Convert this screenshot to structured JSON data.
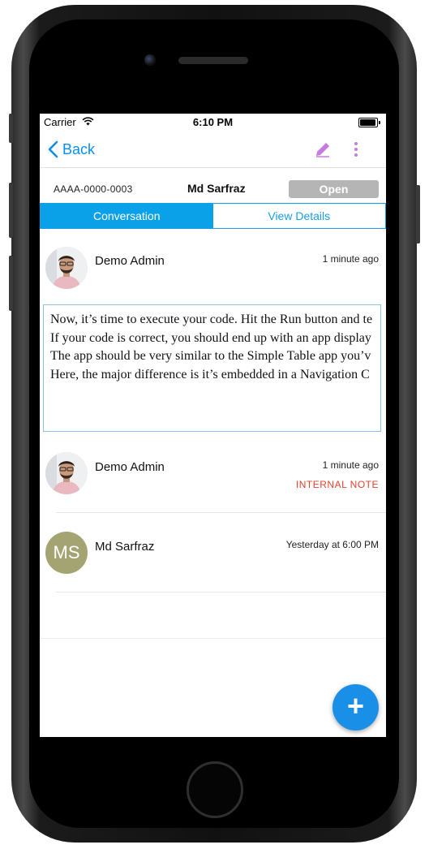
{
  "statusbar": {
    "carrier": "Carrier",
    "time": "6:10 PM"
  },
  "navbar": {
    "back_label": "Back"
  },
  "ticket": {
    "id": "AAAA-0000-0003",
    "requester": "Md Sarfraz",
    "status": "Open"
  },
  "tabs": [
    {
      "label": "Conversation",
      "active": true
    },
    {
      "label": "View Details",
      "active": false
    }
  ],
  "entries": [
    {
      "author": "Demo Admin",
      "time": "1 minute ago",
      "message": [
        "Now, it’s time to execute your code. Hit the Run button and te",
        "If your code is correct, you should end up with an app display",
        "The app should be very similar to the Simple Table app you’v",
        "Here, the major difference is it’s embedded in a Navigation C"
      ]
    },
    {
      "author": "Demo Admin",
      "time": "1 minute ago",
      "tag": "INTERNAL NOTE"
    },
    {
      "author": "Md Sarfraz",
      "initials": "MS",
      "time": "Yesterday at 6:00 PM"
    }
  ],
  "fab": {
    "label": "+"
  },
  "colors": {
    "accent": "#0aa1e8",
    "link": "#0a8fe8",
    "internal_note": "#e4422e",
    "edit_icon": "#c77be0",
    "avatar_initials_bg": "#a4a372"
  }
}
